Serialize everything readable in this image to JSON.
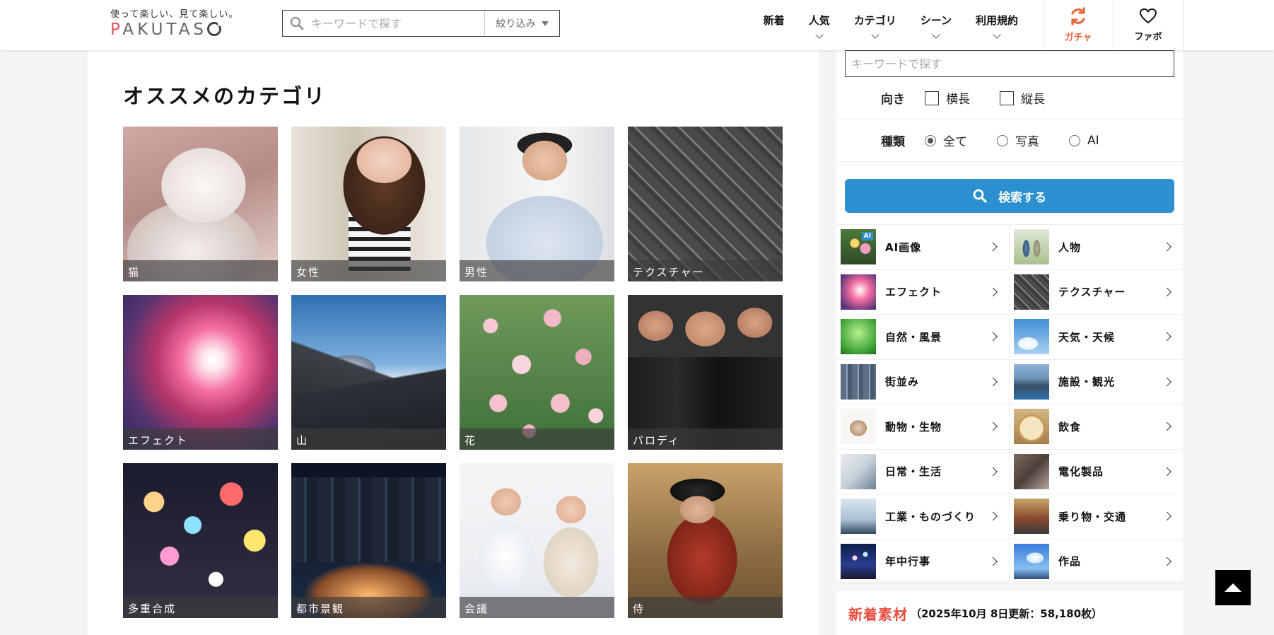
{
  "header": {
    "logo_tagline": "使って楽しい、見て楽しい。",
    "logo_p": "P",
    "logo_mid": "AKUTAS",
    "search_placeholder": "キーワードで探す",
    "narrow_label": "絞り込み",
    "nav": [
      {
        "label": "新着",
        "has_dropdown": false
      },
      {
        "label": "人気",
        "has_dropdown": true
      },
      {
        "label": "カテゴリ",
        "has_dropdown": true
      },
      {
        "label": "シーン",
        "has_dropdown": true
      },
      {
        "label": "利用規約",
        "has_dropdown": true
      }
    ],
    "gacha_label": "ガチャ",
    "fav_label": "ファボ",
    "colors": {
      "accent_orange": "#e8663a",
      "logo_red": "#e2545b"
    }
  },
  "main": {
    "section_title": "オススメのカテゴリ",
    "tiles": [
      {
        "label": "猫",
        "art": "t-cat"
      },
      {
        "label": "女性",
        "art": "t-woman"
      },
      {
        "label": "男性",
        "art": "t-man"
      },
      {
        "label": "テクスチャー",
        "art": "t-texture"
      },
      {
        "label": "エフェクト",
        "art": "t-effect"
      },
      {
        "label": "山",
        "art": "t-mountain"
      },
      {
        "label": "花",
        "art": "t-flowers"
      },
      {
        "label": "パロディ",
        "art": "t-parody"
      },
      {
        "label": "多重合成",
        "art": "t-multi"
      },
      {
        "label": "都市景観",
        "art": "t-city"
      },
      {
        "label": "会議",
        "art": "t-meeting"
      },
      {
        "label": "侍",
        "art": "t-samurai"
      }
    ]
  },
  "sidebar": {
    "search_placeholder": "キーワードで探す",
    "orientation": {
      "label": "向き",
      "options": [
        {
          "label": "横長",
          "checked": false
        },
        {
          "label": "縦長",
          "checked": false
        }
      ]
    },
    "kind": {
      "label": "種類",
      "options": [
        {
          "label": "全て",
          "selected": true
        },
        {
          "label": "写真",
          "selected": false
        },
        {
          "label": "AI",
          "selected": false
        }
      ]
    },
    "search_button": "検索する",
    "button_color": "#2b8fd0",
    "categories": [
      {
        "label": "AI画像",
        "thumb": "th-ai"
      },
      {
        "label": "人物",
        "thumb": "th-person"
      },
      {
        "label": "エフェクト",
        "thumb": "th-effect"
      },
      {
        "label": "テクスチャー",
        "thumb": "th-texture"
      },
      {
        "label": "自然・風景",
        "thumb": "th-nature"
      },
      {
        "label": "天気・天候",
        "thumb": "th-weather"
      },
      {
        "label": "街並み",
        "thumb": "th-street"
      },
      {
        "label": "施設・観光",
        "thumb": "th-facility"
      },
      {
        "label": "動物・生物",
        "thumb": "th-animal"
      },
      {
        "label": "飲食",
        "thumb": "th-food"
      },
      {
        "label": "日常・生活",
        "thumb": "th-daily"
      },
      {
        "label": "電化製品",
        "thumb": "th-electric"
      },
      {
        "label": "工業・ものづくり",
        "thumb": "th-industry"
      },
      {
        "label": "乗り物・交通",
        "thumb": "th-vehicle"
      },
      {
        "label": "年中行事",
        "thumb": "th-event"
      },
      {
        "label": "作品",
        "thumb": "th-works"
      }
    ],
    "new_title": "新着素材",
    "new_sub": "（2025年10月 8日更新：58,180枚）",
    "new_title_color": "#e84d3d"
  }
}
